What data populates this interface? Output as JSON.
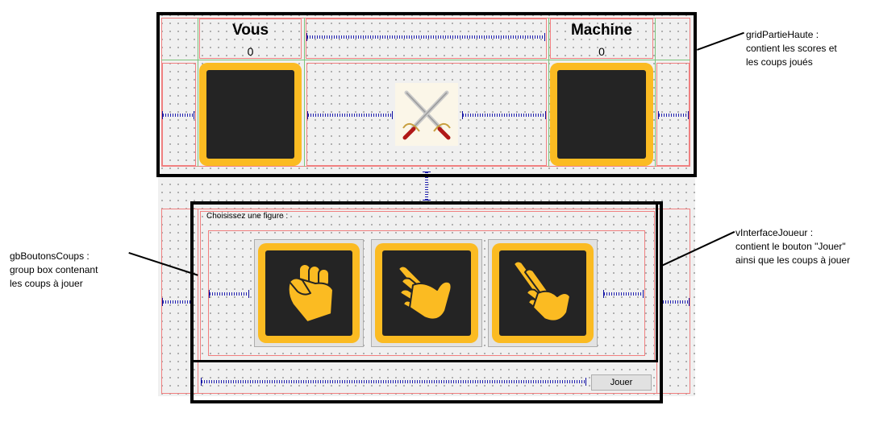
{
  "players": {
    "human": {
      "title": "Vous",
      "score": "0"
    },
    "machine": {
      "title": "Machine",
      "score": "0"
    }
  },
  "versus_icon": "crossed-swords-icon",
  "group_box": {
    "title": "Choisissez une figure :"
  },
  "moves": [
    {
      "name": "rock",
      "icon": "fist-icon"
    },
    {
      "name": "paper",
      "icon": "open-hand-icon"
    },
    {
      "name": "scissors",
      "icon": "victory-hand-icon"
    }
  ],
  "play_button": {
    "label": "Jouer"
  },
  "annotations": {
    "grid_top": "gridPartieHaute :\ncontient les scores et\nles coups joués",
    "group_buttons": "gbBoutonsCoups :\ngroup box contenant\nles coups à jouer",
    "player_interface": "vInterfaceJoueur :\ncontient le bouton \"Jouer\"\nainsi que les coups à jouer"
  },
  "colors": {
    "tile_frame": "#fbbb22",
    "tile_inner": "#242424",
    "layout_border": "#f08080",
    "spacer": "#2020b0",
    "annotation_box": "#000000"
  }
}
